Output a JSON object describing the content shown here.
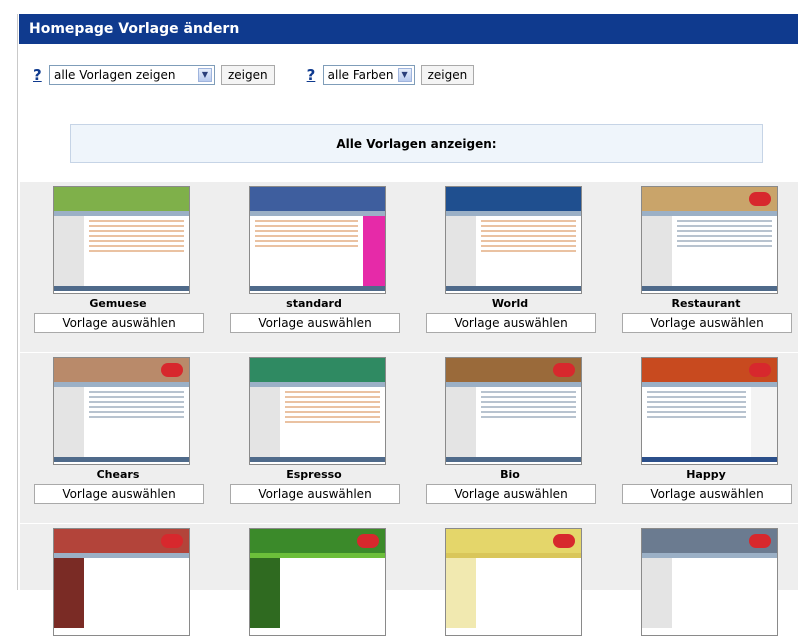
{
  "header": {
    "title": "Homepage Vorlage ändern"
  },
  "filters": {
    "help_mark": "?",
    "templates_select": "alle Vorlagen zeigen",
    "colors_select": "alle Farben",
    "show_label": "zeigen"
  },
  "info": {
    "text": "Alle Vorlagen anzeigen:"
  },
  "choose_label": "Vorlage auswählen",
  "templates": [
    {
      "name": "Gemuese",
      "head_color": "#7fb04a",
      "accent": "#9cc45a"
    },
    {
      "name": "standard",
      "head_color": "#3e5e9e",
      "accent": "#c46a3a"
    },
    {
      "name": "World",
      "head_color": "#1f4f8f",
      "accent": "#2c6aa8"
    },
    {
      "name": "Restaurant",
      "head_color": "#c9a46a",
      "accent": "#d7282d"
    },
    {
      "name": "Chears",
      "head_color": "#b98a6a",
      "accent": "#d7282d"
    },
    {
      "name": "Espresso",
      "head_color": "#2f8a62",
      "accent": "#c46a3a"
    },
    {
      "name": "Bio",
      "head_color": "#9a6a3a",
      "accent": "#d7282d"
    },
    {
      "name": "Happy",
      "head_color": "#c84a1f",
      "accent": "#d7282d"
    }
  ],
  "row3_heads": [
    "#b3443a",
    "#3b8a2a",
    "#e4d66a",
    "#6b7b90"
  ],
  "colors": {
    "header_bg": "#0f3a8e",
    "row_bg": "#eeeeee",
    "info_bg": "#eff5fb"
  }
}
